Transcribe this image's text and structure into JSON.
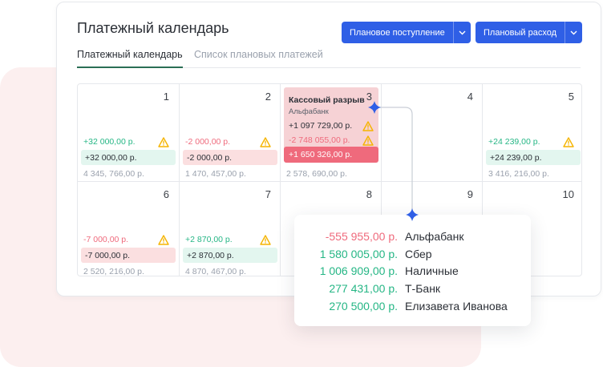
{
  "title": "Платежный календарь",
  "tabs": [
    {
      "label": "Платежный календарь"
    },
    {
      "label": "Список плановых платежей"
    }
  ],
  "buttons": {
    "income": "Плановое поступление",
    "expense": "Плановый расход"
  },
  "days": [
    {
      "day": "1",
      "top_amount": "+32 000,00 р.",
      "chip": "+32 000,00 р.",
      "balance": "4 345, 766,00 р."
    },
    {
      "day": "2",
      "top_amount": "-2 000,00 р.",
      "chip": "-2 000,00 р.",
      "balance": "1 470, 457,00 р."
    },
    {
      "day": "3",
      "cash_gap": {
        "title": "Кассовый разрыв",
        "bank": "Альфабанк",
        "line1": "+1 097 729,00 р.",
        "line2": "-2 748 055,00 р.",
        "total": "+1 650 326,00 р."
      },
      "balance": "2 578, 690,00 р."
    },
    {
      "day": "4"
    },
    {
      "day": "5",
      "top_amount": "+24 239,00 р.",
      "chip": "+24 239,00 р.",
      "balance": "3 416, 216,00 р."
    },
    {
      "day": "6",
      "top_amount": "-7 000,00 р.",
      "chip": "-7 000,00 р.",
      "balance": "2 520, 216,00 р."
    },
    {
      "day": "7",
      "top_amount": "+2 870,00 р.",
      "chip": "+2 870,00 р.",
      "balance": "4 870, 467,00 р."
    },
    {
      "day": "8"
    },
    {
      "day": "9"
    },
    {
      "day": "10"
    }
  ],
  "popup": [
    {
      "amount": "-555 955,00 р.",
      "name": "Альфабанк"
    },
    {
      "amount": "1 580 005,00 р.",
      "name": "Сбер"
    },
    {
      "amount": "1 006 909,00 р.",
      "name": "Наличные"
    },
    {
      "amount": "277 431,00 р.",
      "name": "Т-Банк"
    },
    {
      "amount": "270 500,00 р.",
      "name": "Елизавета Иванова"
    }
  ],
  "colors": {
    "accent": "#2f5fe6",
    "positive": "#25b685",
    "negative": "#ef6a7c",
    "warning": "#f5b400"
  },
  "icons": {
    "warning": "warning-triangle-icon",
    "caret": "chevron-down-icon",
    "connector_star": "sparkle-icon"
  }
}
